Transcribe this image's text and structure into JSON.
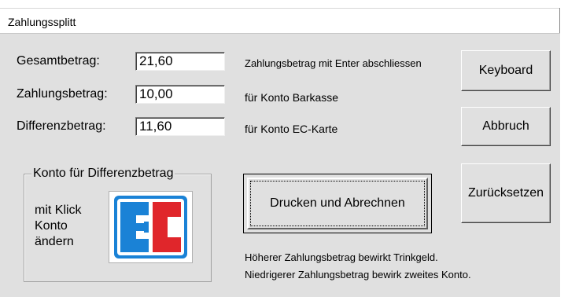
{
  "window": {
    "title": "Zahlungssplitt"
  },
  "amounts": {
    "gesamt_label": "Gesamtbetrag:",
    "gesamt_value": "21,60",
    "zahlung_label": "Zahlungsbetrag:",
    "zahlung_value": "10,00",
    "differenz_label": "Differenzbetrag:",
    "differenz_value": "11,60"
  },
  "info": {
    "enter_hint": "Zahlungsbetrag mit Enter abschliessen",
    "konto_zahlung": "für Konto Barkasse",
    "konto_differenz": "für Konto EC-Karte",
    "note_line1": "Höherer Zahlungsbetrag bewirkt Trinkgeld.",
    "note_line2": "Niedrigerer Zahlungsbetrag bewirk zweites Konto."
  },
  "group": {
    "legend": "Konto für Differenzbetrag",
    "click_line1": "mit Klick",
    "click_line2": "Konto",
    "click_line3": "ändern",
    "logo_icon": "ec-card-logo",
    "logo_colors": {
      "blue": "#1a82d6",
      "red": "#e0262b"
    }
  },
  "buttons": {
    "keyboard": "Keyboard",
    "abbruch": "Abbruch",
    "zuruecksetzen": "Zurücksetzen",
    "drucken": "Drucken und Abrechnen"
  }
}
